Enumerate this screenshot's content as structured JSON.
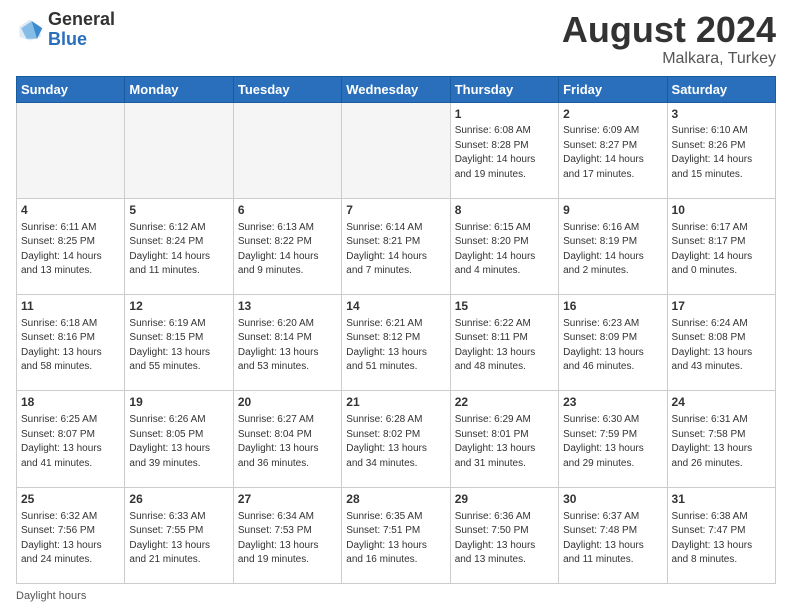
{
  "logo": {
    "general": "General",
    "blue": "Blue"
  },
  "title": "August 2024",
  "location": "Malkara, Turkey",
  "days_of_week": [
    "Sunday",
    "Monday",
    "Tuesday",
    "Wednesday",
    "Thursday",
    "Friday",
    "Saturday"
  ],
  "footer": "Daylight hours",
  "weeks": [
    [
      {
        "day": "",
        "info": ""
      },
      {
        "day": "",
        "info": ""
      },
      {
        "day": "",
        "info": ""
      },
      {
        "day": "",
        "info": ""
      },
      {
        "day": "1",
        "info": "Sunrise: 6:08 AM\nSunset: 8:28 PM\nDaylight: 14 hours\nand 19 minutes."
      },
      {
        "day": "2",
        "info": "Sunrise: 6:09 AM\nSunset: 8:27 PM\nDaylight: 14 hours\nand 17 minutes."
      },
      {
        "day": "3",
        "info": "Sunrise: 6:10 AM\nSunset: 8:26 PM\nDaylight: 14 hours\nand 15 minutes."
      }
    ],
    [
      {
        "day": "4",
        "info": "Sunrise: 6:11 AM\nSunset: 8:25 PM\nDaylight: 14 hours\nand 13 minutes."
      },
      {
        "day": "5",
        "info": "Sunrise: 6:12 AM\nSunset: 8:24 PM\nDaylight: 14 hours\nand 11 minutes."
      },
      {
        "day": "6",
        "info": "Sunrise: 6:13 AM\nSunset: 8:22 PM\nDaylight: 14 hours\nand 9 minutes."
      },
      {
        "day": "7",
        "info": "Sunrise: 6:14 AM\nSunset: 8:21 PM\nDaylight: 14 hours\nand 7 minutes."
      },
      {
        "day": "8",
        "info": "Sunrise: 6:15 AM\nSunset: 8:20 PM\nDaylight: 14 hours\nand 4 minutes."
      },
      {
        "day": "9",
        "info": "Sunrise: 6:16 AM\nSunset: 8:19 PM\nDaylight: 14 hours\nand 2 minutes."
      },
      {
        "day": "10",
        "info": "Sunrise: 6:17 AM\nSunset: 8:17 PM\nDaylight: 14 hours\nand 0 minutes."
      }
    ],
    [
      {
        "day": "11",
        "info": "Sunrise: 6:18 AM\nSunset: 8:16 PM\nDaylight: 13 hours\nand 58 minutes."
      },
      {
        "day": "12",
        "info": "Sunrise: 6:19 AM\nSunset: 8:15 PM\nDaylight: 13 hours\nand 55 minutes."
      },
      {
        "day": "13",
        "info": "Sunrise: 6:20 AM\nSunset: 8:14 PM\nDaylight: 13 hours\nand 53 minutes."
      },
      {
        "day": "14",
        "info": "Sunrise: 6:21 AM\nSunset: 8:12 PM\nDaylight: 13 hours\nand 51 minutes."
      },
      {
        "day": "15",
        "info": "Sunrise: 6:22 AM\nSunset: 8:11 PM\nDaylight: 13 hours\nand 48 minutes."
      },
      {
        "day": "16",
        "info": "Sunrise: 6:23 AM\nSunset: 8:09 PM\nDaylight: 13 hours\nand 46 minutes."
      },
      {
        "day": "17",
        "info": "Sunrise: 6:24 AM\nSunset: 8:08 PM\nDaylight: 13 hours\nand 43 minutes."
      }
    ],
    [
      {
        "day": "18",
        "info": "Sunrise: 6:25 AM\nSunset: 8:07 PM\nDaylight: 13 hours\nand 41 minutes."
      },
      {
        "day": "19",
        "info": "Sunrise: 6:26 AM\nSunset: 8:05 PM\nDaylight: 13 hours\nand 39 minutes."
      },
      {
        "day": "20",
        "info": "Sunrise: 6:27 AM\nSunset: 8:04 PM\nDaylight: 13 hours\nand 36 minutes."
      },
      {
        "day": "21",
        "info": "Sunrise: 6:28 AM\nSunset: 8:02 PM\nDaylight: 13 hours\nand 34 minutes."
      },
      {
        "day": "22",
        "info": "Sunrise: 6:29 AM\nSunset: 8:01 PM\nDaylight: 13 hours\nand 31 minutes."
      },
      {
        "day": "23",
        "info": "Sunrise: 6:30 AM\nSunset: 7:59 PM\nDaylight: 13 hours\nand 29 minutes."
      },
      {
        "day": "24",
        "info": "Sunrise: 6:31 AM\nSunset: 7:58 PM\nDaylight: 13 hours\nand 26 minutes."
      }
    ],
    [
      {
        "day": "25",
        "info": "Sunrise: 6:32 AM\nSunset: 7:56 PM\nDaylight: 13 hours\nand 24 minutes."
      },
      {
        "day": "26",
        "info": "Sunrise: 6:33 AM\nSunset: 7:55 PM\nDaylight: 13 hours\nand 21 minutes."
      },
      {
        "day": "27",
        "info": "Sunrise: 6:34 AM\nSunset: 7:53 PM\nDaylight: 13 hours\nand 19 minutes."
      },
      {
        "day": "28",
        "info": "Sunrise: 6:35 AM\nSunset: 7:51 PM\nDaylight: 13 hours\nand 16 minutes."
      },
      {
        "day": "29",
        "info": "Sunrise: 6:36 AM\nSunset: 7:50 PM\nDaylight: 13 hours\nand 13 minutes."
      },
      {
        "day": "30",
        "info": "Sunrise: 6:37 AM\nSunset: 7:48 PM\nDaylight: 13 hours\nand 11 minutes."
      },
      {
        "day": "31",
        "info": "Sunrise: 6:38 AM\nSunset: 7:47 PM\nDaylight: 13 hours\nand 8 minutes."
      }
    ]
  ]
}
